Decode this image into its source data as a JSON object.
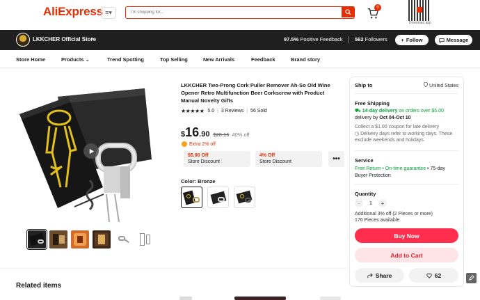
{
  "header": {
    "logo": "AliExpress",
    "menu_label": "≡▾",
    "search_placeholder": "I'm shopping for...",
    "cart_count": "0",
    "download_label": "Download app"
  },
  "store": {
    "name": "LKKCHER Official Store",
    "positive_feedback": "97.5%",
    "positive_feedback_label": "Positive Feedback",
    "followers": "562",
    "followers_label": "Followers",
    "follow_label": "Follow",
    "message_label": "Message"
  },
  "nav": {
    "items": [
      "Store Home",
      "Products",
      "Trend Spotting",
      "Top Selling",
      "New Arrivals",
      "Feedback",
      "Brand story"
    ]
  },
  "product": {
    "title": "LKKCHER Two-Prong Cork Puller Remover Ah-So Old Wine Opener Retro Multifunction Beer Corkscrew with Product Manual Novelty Gifts",
    "stars": "★★★★★",
    "rating": "5.0",
    "reviews": "3 Reviews",
    "sold": "56 Sold",
    "price_currency": "$",
    "price_int": "16",
    "price_dec": ".90",
    "price_old": "$28.16",
    "discount_pct": "40% off",
    "extra_off": "Extra 2% off",
    "coupons": [
      {
        "title": "$5.00 Off",
        "subtitle": "Store Discount"
      },
      {
        "title": "4% Off",
        "subtitle": "Store Discount"
      }
    ],
    "more_label": "•••",
    "color_label": "Color: Bronze",
    "related_title": "Related items"
  },
  "shipping": {
    "ship_to_label": "Ship to",
    "ship_to_location": "United States",
    "free_shipping": "Free Shipping",
    "delivery_days": "14-day delivery",
    "delivery_condition": "on orders over $5.00",
    "delivery_by_prefix": "delivery by",
    "delivery_by_date": "Oct 04-Oct 10",
    "late_coupon": "Collect a $1.00 coupon for late delivery",
    "working_days_note": "Delivery days refer to working days. These exclude weekends and holidays."
  },
  "service": {
    "label": "Service",
    "free_return": "Free Return",
    "on_time": "On-time guarantee",
    "buyer_protection": "75-day Buyer Protection"
  },
  "quantity": {
    "label": "Quantity",
    "value": "1",
    "additional_discount": "Additional 3% off (2 Pieces or more)",
    "available": "176 Pieces available"
  },
  "actions": {
    "buy_now": "Buy Now",
    "add_to_cart": "Add to Cart",
    "share": "Share",
    "wishlist_count": "62"
  },
  "colors": {
    "brand_red": "#e62e04",
    "buy_red": "#ff2e4c",
    "green": "#00a535",
    "store_bar": "#1f1f1f"
  }
}
